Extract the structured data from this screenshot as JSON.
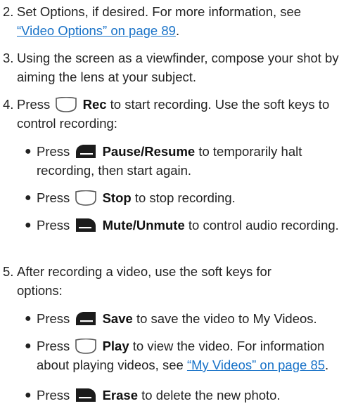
{
  "step2": {
    "num": "2.",
    "text": "Set Options, if desired. For more information, see",
    "link": "“Video Options” on page 89",
    "end": "."
  },
  "step3": {
    "num": "3.",
    "text": "Using the screen as a viewfinder, compose your shot by aiming the lens at your subject."
  },
  "step4": {
    "num": "4.",
    "pre": "Press",
    "key": "Rec",
    "post": "to start recording. Use the soft keys to control recording:"
  },
  "step4_bullets": [
    {
      "pre": "Press",
      "key": "Pause/Resume",
      "post": "to temporarily halt recording, then start again.",
      "icon": "left-softkey-icon"
    },
    {
      "pre": "Press",
      "key": "Stop",
      "post": "to stop recording.",
      "icon": "center-key-icon"
    },
    {
      "pre": "Press",
      "key": "Mute/Unmute",
      "post": "to control audio recording.",
      "icon": "right-softkey-icon"
    }
  ],
  "step5": {
    "num": "5.",
    "text": "After recording a video, use the soft keys for options:"
  },
  "step5_bullets": [
    {
      "pre": "Press",
      "key": "Save",
      "post": "to save the video to My Videos.",
      "icon": "left-softkey-icon"
    },
    {
      "pre": "Press",
      "key": "Play",
      "post": "to view the video. For information about playing videos, see",
      "link": "“My Videos” on page 85",
      "end": ".",
      "icon": "center-key-icon"
    },
    {
      "pre": "Press",
      "key": "Erase",
      "post": "to delete the new photo.",
      "icon": "right-softkey-icon"
    }
  ]
}
